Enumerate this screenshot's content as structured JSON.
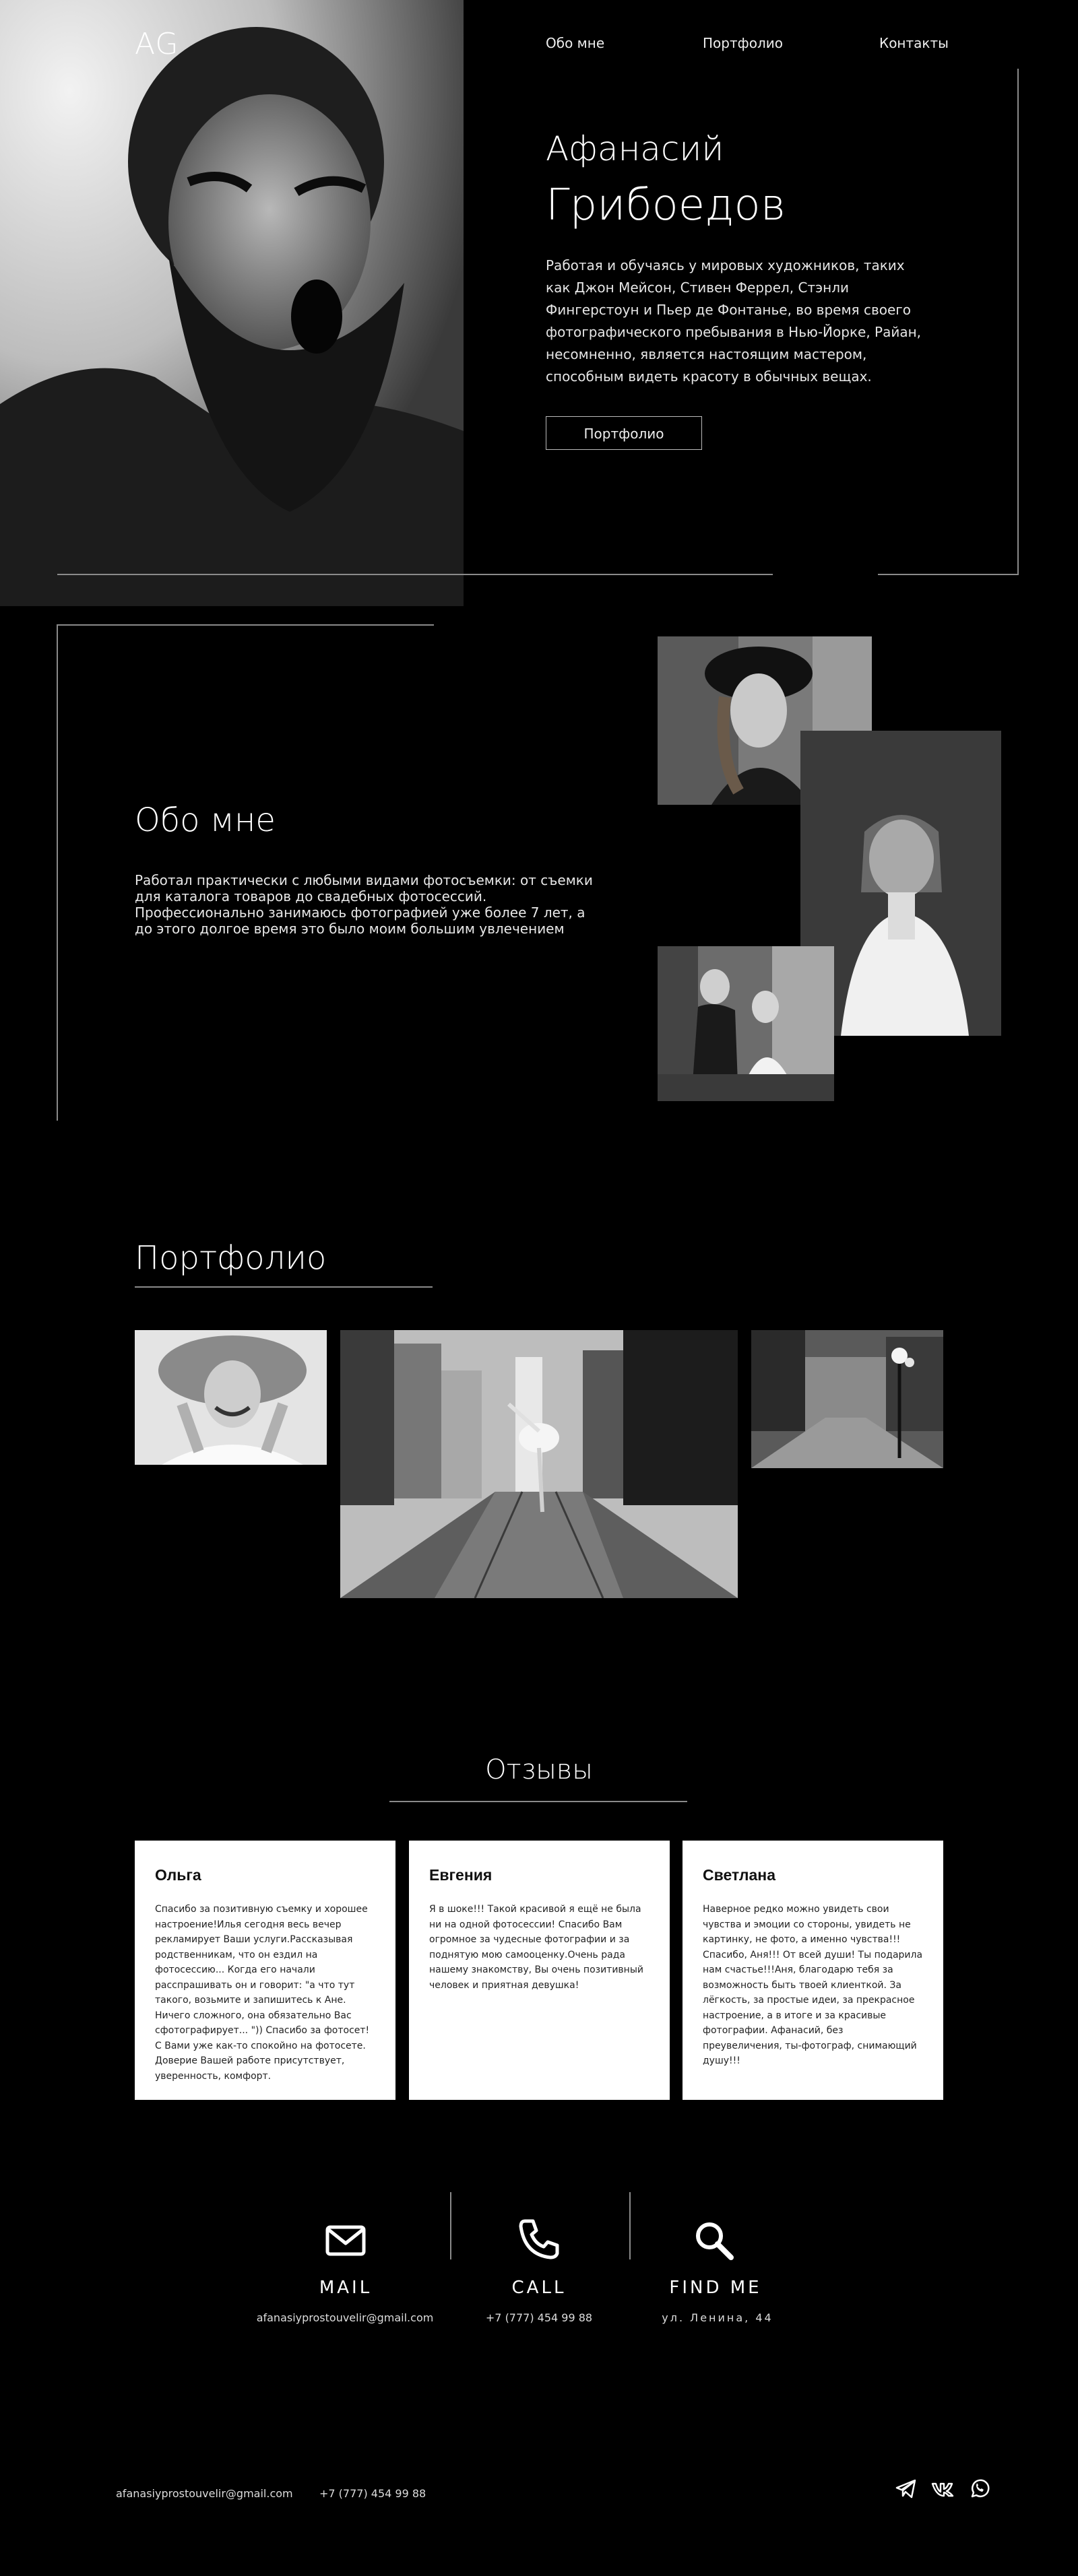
{
  "header": {
    "logo": "AG",
    "nav": [
      "Обо мне",
      "Портфолио",
      "Контакты"
    ]
  },
  "hero": {
    "first_name": "Афанасий",
    "last_name": "Грибоедов",
    "description": "Работая и обучаясь у мировых художников, таких как Джон Мейсон, Стивен Феррел, Стэнли Фингерстоун и Пьер де Фонтанье, во время своего фотографического пребывания в Нью-Йорке, Райан, несомненно, является настоящим мастером, способным видеть красоту в обычных вещах.",
    "button": "Портфолио"
  },
  "about": {
    "title": "Обо мне",
    "text": "Работал практически с любыми видами фотосъемки: от съемки для каталога  товаров до свадебных фотосессий. Профессионально занимаюсь фотографией уже более 7 лет, а до этого долгое время это было моим большим увлечением"
  },
  "portfolio": {
    "title": "Портфолио"
  },
  "reviews": {
    "title": "Отзывы",
    "items": [
      {
        "name": "Ольга",
        "text": "Спасибо за позитивную съемку и хорошее настроение!Илья сегодня весь вечер рекламирует Ваши услуги.Рассказывая родственникам, что он ездил на фотосессию... Когда его начали расспрашивать он и говорит: \"а что тут такого, возьмите и запишитесь к Ане. Ничего сложного, она обязательно Вас сфотографирует... \")) Спасибо за фотосет!С Вами уже как-то спокойно на фотосете. Доверие Вашей работе присутствует, уверенность, комфорт."
      },
      {
        "name": "Евгения",
        "text": "Я в шоке!!! Такой красивой я ещё не была ни на одной фотосессии! Спасибо Вам огромное за чудесные фотографии и за поднятую мою самооценку.Очень рада нашему знакомству, Вы очень позитивный человек и приятная девушка!"
      },
      {
        "name": "Светлана",
        "text": "Наверное редко можно увидеть свои чувства и эмоции со стороны, увидеть не картинку, не фото, а именно чувства!!! Спасибо, Аня!!! От всей души! Ты подарила нам счастье!!!Аня, благодарю тебя за возможность быть твоей клиенткой. За лёгкость, за простые идеи, за прекрасное настроение, а в итоге и за красивые фотографии. Афанасий, без преувеличения, ты-фотограф, снимающий душу!!!"
      }
    ]
  },
  "contacts": {
    "mail": {
      "label": "MAIL",
      "value": "afanasiyprostouvelir@gmail.com",
      "icon": "mail-icon"
    },
    "call": {
      "label": "CALL",
      "value": "+7 (777) 454 99 88",
      "icon": "phone-icon"
    },
    "find": {
      "label": "FIND ME",
      "value": "ул. Ленина, 44",
      "icon": "search-icon"
    }
  },
  "footer": {
    "email": "afanasiyprostouvelir@gmail.com",
    "phone": "+7 (777) 454 99 88",
    "social_icons": [
      "telegram-icon",
      "vk-icon",
      "whatsapp-icon"
    ]
  },
  "colors": {
    "background": "#000000",
    "text": "#ffffff",
    "line": "#8a8a8a",
    "card": "#ffffff"
  }
}
